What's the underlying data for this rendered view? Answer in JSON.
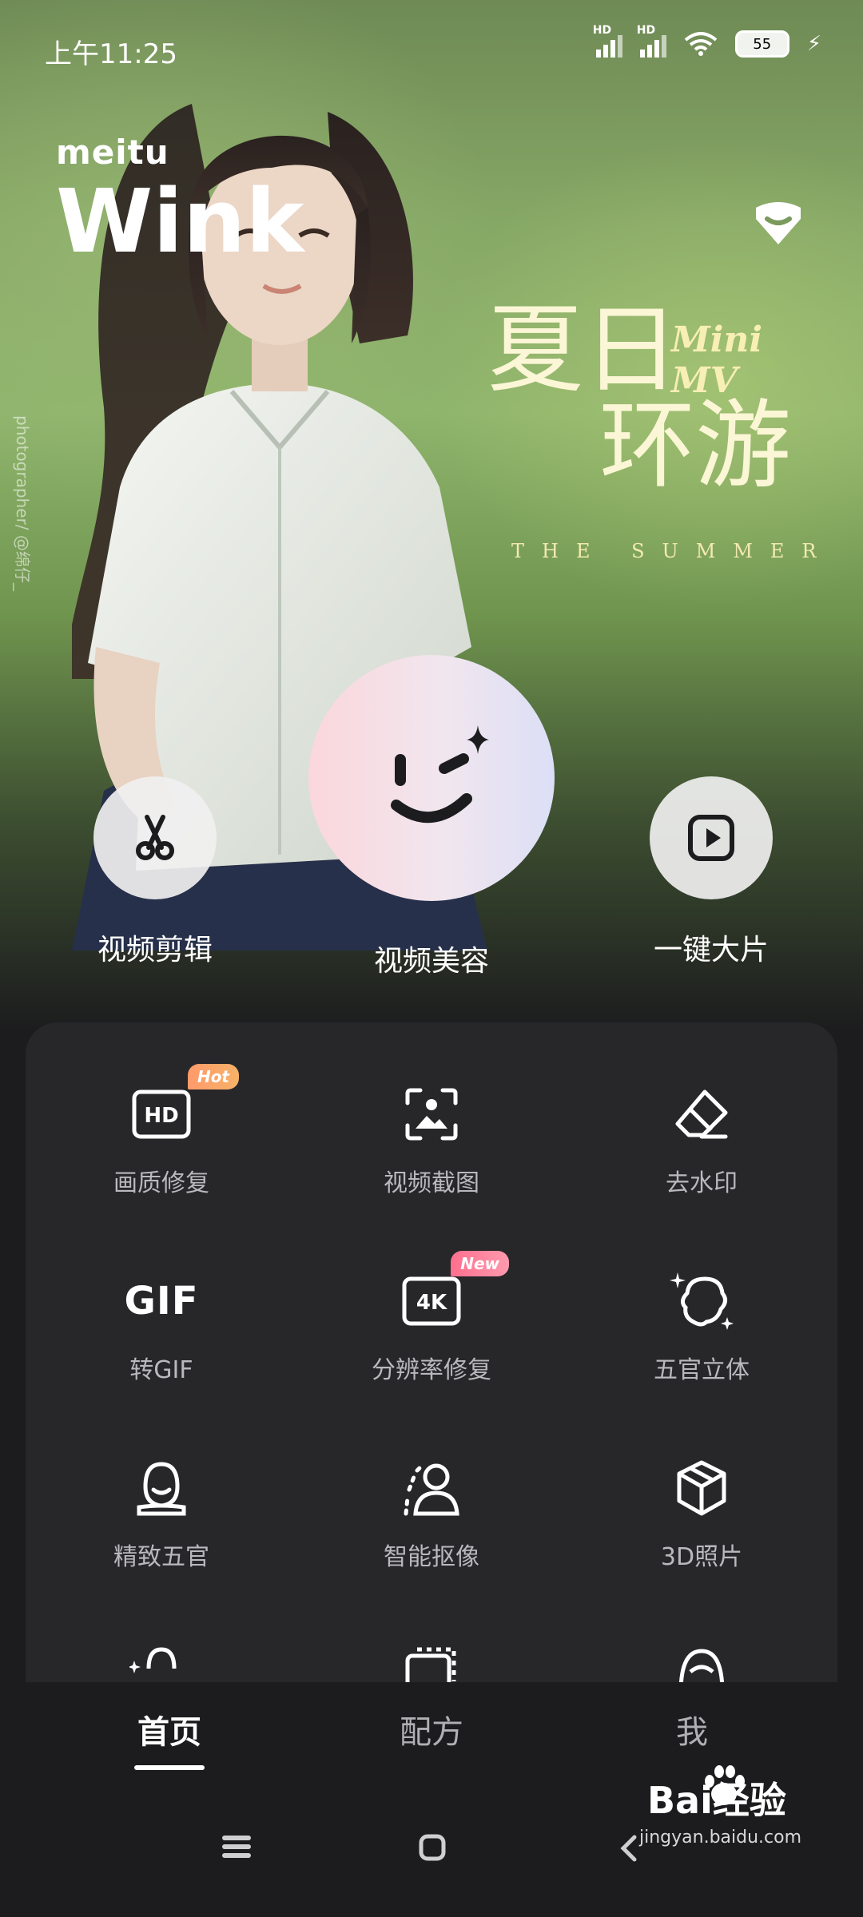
{
  "status": {
    "time": "上午11:25",
    "hd1": "HD",
    "hd2": "HD",
    "battery": "55"
  },
  "brand": {
    "top": "meitu",
    "main": "Wink"
  },
  "promo": {
    "line1": "夏日",
    "line2": "环游",
    "mini": "Mini MV",
    "english": "THE SUMMER",
    "credit": "photographer/ @绵仔_"
  },
  "actions": [
    {
      "label": "视频剪辑",
      "icon": "scissors-icon"
    },
    {
      "label": "视频美容",
      "icon": "wink-face-icon"
    },
    {
      "label": "一键大片",
      "icon": "play-icon"
    }
  ],
  "tools": [
    {
      "label": "画质修复",
      "icon": "hd-icon",
      "badge": "Hot"
    },
    {
      "label": "视频截图",
      "icon": "screenshot-icon"
    },
    {
      "label": "去水印",
      "icon": "eraser-icon"
    },
    {
      "label": "转GIF",
      "icon": "gif-icon",
      "icon_text": "GIF"
    },
    {
      "label": "分辨率修复",
      "icon": "4k-icon",
      "badge": "New",
      "icon_text": "4K"
    },
    {
      "label": "五官立体",
      "icon": "face-contour-icon"
    },
    {
      "label": "精致五官",
      "icon": "face-refine-icon"
    },
    {
      "label": "智能抠像",
      "icon": "portrait-cutout-icon"
    },
    {
      "label": "3D照片",
      "icon": "cube-icon"
    }
  ],
  "tabs": [
    {
      "label": "首页",
      "active": true
    },
    {
      "label": "配方",
      "active": false
    },
    {
      "label": "我",
      "active": false
    }
  ],
  "watermark": {
    "text": "Bai经验",
    "sub": "jingyan.baidu.com"
  }
}
